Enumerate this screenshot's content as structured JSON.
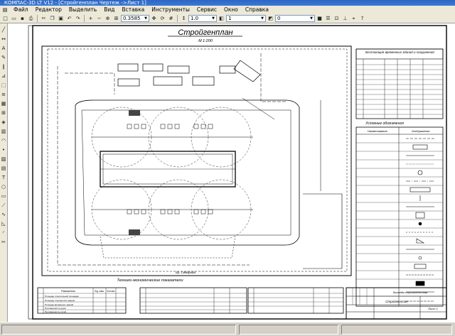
{
  "window": {
    "title": "КОМПАС-3D LT V12 - [Стройгенплан Чертеж ->Лист 1]"
  },
  "menu": {
    "items": [
      "Файл",
      "Редактор",
      "Выделить",
      "Вид",
      "Вставка",
      "Инструменты",
      "Сервис",
      "Окно",
      "Справка"
    ]
  },
  "toolbar": {
    "zoom_value": "0.3585",
    "line_scale": "1.0",
    "layer": "1",
    "style_value": "0"
  },
  "drawing": {
    "title": "Стройгенплан",
    "scale": "М 1:200",
    "explication_title": "Экспликация временных зданий и сооружений",
    "legend_title": "Условные обозначения",
    "legend_col_name": "Наименование",
    "legend_col_symbol": "Изображение",
    "tep_title": "Технико-экономические показатели",
    "tep_col_name": "Показатель",
    "tep_col_unit": "Ед. изм.",
    "tep_col_qty": "Кол-во",
    "tep_rows": [
      "Площадь строительной площадки",
      "Площадь строящегося здания",
      "Площадь временных зданий",
      "Протяженность дорог",
      "Протяженность сетей"
    ],
    "north_label": "пр. Северная",
    "stamp_org": "Колледж строительства",
    "stamp_doc": "Стройгенплан",
    "stamp_sheet": "Лист 1"
  }
}
